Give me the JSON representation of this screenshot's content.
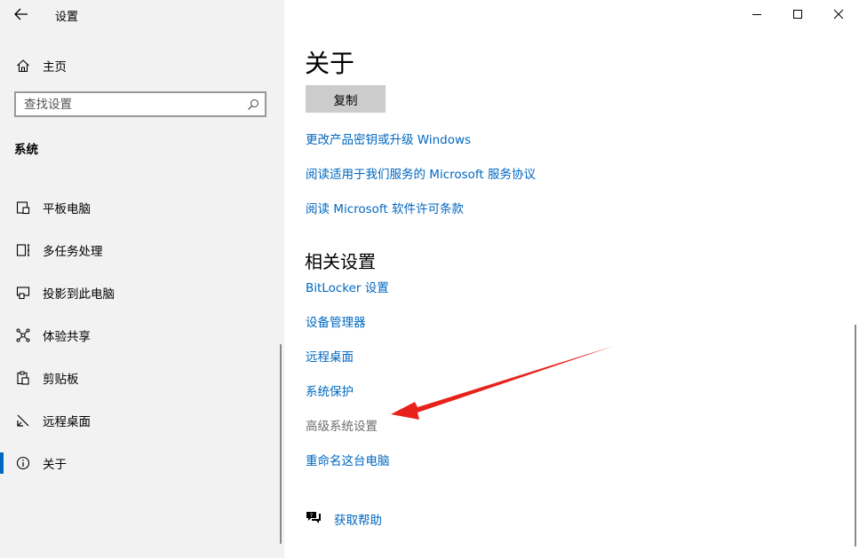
{
  "window": {
    "title": "设置",
    "controls": {
      "minimize": "minimize",
      "maximize": "maximize",
      "close": "close"
    }
  },
  "sidebar": {
    "home_label": "主页",
    "search_placeholder": "查找设置",
    "section_title": "系统",
    "items": [
      {
        "label": "平板电脑",
        "icon": "tablet-icon"
      },
      {
        "label": "多任务处理",
        "icon": "multitask-icon"
      },
      {
        "label": "投影到此电脑",
        "icon": "project-icon"
      },
      {
        "label": "体验共享",
        "icon": "share-icon"
      },
      {
        "label": "剪贴板",
        "icon": "clipboard-icon"
      },
      {
        "label": "远程桌面",
        "icon": "remote-desktop-icon"
      },
      {
        "label": "关于",
        "icon": "info-icon",
        "selected": true
      }
    ]
  },
  "main": {
    "title": "关于",
    "copy_button": "复制",
    "links": [
      "更改产品密钥或升级 Windows",
      "阅读适用于我们服务的 Microsoft 服务协议",
      "阅读 Microsoft 软件许可条款"
    ],
    "related_title": "相关设置",
    "related_links": [
      "BitLocker 设置",
      "设备管理器",
      "远程桌面",
      "系统保护",
      "高级系统设置",
      "重命名这台电脑"
    ],
    "help_label": "获取帮助"
  },
  "colors": {
    "accent": "#0067c0",
    "sidebar_bg": "#f2f2f2",
    "arrow": "#e8221b"
  }
}
